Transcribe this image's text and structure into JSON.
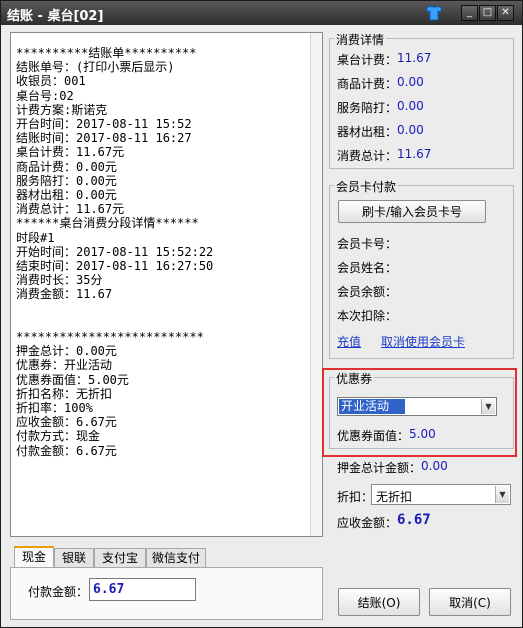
{
  "window": {
    "title": "结账 - 桌台[02]",
    "minimize": "_",
    "maximize": "□",
    "close": "✕"
  },
  "receipt": {
    "lines": [
      "**********结账单**********",
      "结账单号：(打印小票后显示)",
      "收银员：001",
      "桌台号:02",
      "计费方案:斯诺克",
      "开台时间：2017-08-11 15:52",
      "结账时间：2017-08-11 16:27",
      "桌台计费：11.67元",
      "商品计费：0.00元",
      "服务陪打：0.00元",
      "器材出租：0.00元",
      "消费总计：11.67元",
      "******桌台消费分段详情******",
      "时段#1",
      "开始时间：2017-08-11 15:52:22",
      "结束时间：2017-08-11 16:27:50",
      "消费时长：35分",
      "消费金额：11.67",
      "",
      "",
      "**************************",
      "押金总计：0.00元",
      "优惠券：开业活动",
      "优惠券面值：5.00元",
      "折扣名称：无折扣",
      "折扣率：100%",
      "应收金额：6.67元",
      "付款方式：现金",
      "付款金额：6.67元"
    ]
  },
  "details": {
    "legend": "消费详情",
    "table_fee_label": "桌台计费：",
    "table_fee": "11.67",
    "goods_fee_label": "商品计费：",
    "goods_fee": "0.00",
    "service_label": "服务陪打：",
    "service": "0.00",
    "rental_label": "器材出租：",
    "rental": "0.00",
    "total_label": "消费总计：",
    "total": "11.67"
  },
  "member": {
    "legend": "会员卡付款",
    "swipe_button": "刷卡/输入会员卡号",
    "card_no_label": "会员卡号：",
    "name_label": "会员姓名：",
    "balance_label": "会员余额：",
    "deduct_label": "本次扣除：",
    "recharge_link": "充值",
    "cancel_link": "取消使用会员卡"
  },
  "coupon": {
    "legend": "优惠券",
    "selected": "开业活动",
    "face_value_label": "优惠券面值：",
    "face_value": "5.00"
  },
  "summary": {
    "deposit_label": "押金总计金额：",
    "deposit": "0.00",
    "discount_label": "折扣：",
    "discount_selected": "无折扣",
    "receivable_label": "应收金额：",
    "receivable": "6.67"
  },
  "payment": {
    "tabs": [
      "现金",
      "银联",
      "支付宝",
      "微信支付"
    ],
    "amount_label": "付款金额：",
    "amount": "6.67"
  },
  "actions": {
    "checkout": "结账(O)",
    "cancel": "取消(C)"
  },
  "colors": {
    "accent_value": "#1a1ab8",
    "highlight_border": "#e03030",
    "selection": "#2f63c9"
  }
}
